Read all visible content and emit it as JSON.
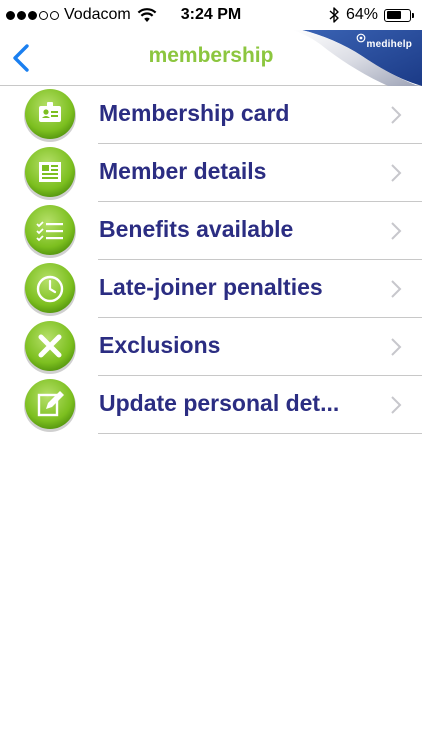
{
  "status_bar": {
    "carrier": "Vodacom",
    "time": "3:24 PM",
    "battery_percent": "64%",
    "battery_level": 0.64,
    "signal_bars_filled": 3,
    "signal_bars_total": 5
  },
  "nav": {
    "title": "membership",
    "brand": "medihelp",
    "back_icon": "chevron-left-icon"
  },
  "colors": {
    "title_green": "#8cc63f",
    "label_navy": "#2b2d82",
    "back_blue": "#1a7ff0",
    "brand_blue": "#1d3f8f"
  },
  "menu": [
    {
      "label": "Membership card",
      "icon": "id-card-icon"
    },
    {
      "label": "Member details",
      "icon": "document-icon"
    },
    {
      "label": "Benefits available",
      "icon": "checklist-icon"
    },
    {
      "label": "Late-joiner penalties",
      "icon": "clock-icon"
    },
    {
      "label": "Exclusions",
      "icon": "x-icon"
    },
    {
      "label": "Update personal det...",
      "icon": "edit-icon"
    }
  ]
}
